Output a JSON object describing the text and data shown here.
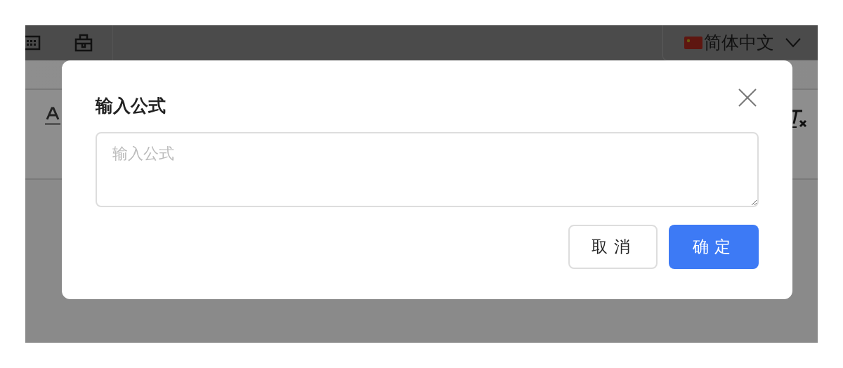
{
  "top_bar": {
    "language": {
      "label": "简体中文"
    }
  },
  "dialog": {
    "title": "输入公式",
    "formula_field": {
      "placeholder": "输入公式"
    },
    "buttons": [
      {
        "label": "取消",
        "kind": "secondary"
      },
      {
        "label": "确定",
        "kind": "primary"
      }
    ]
  }
}
